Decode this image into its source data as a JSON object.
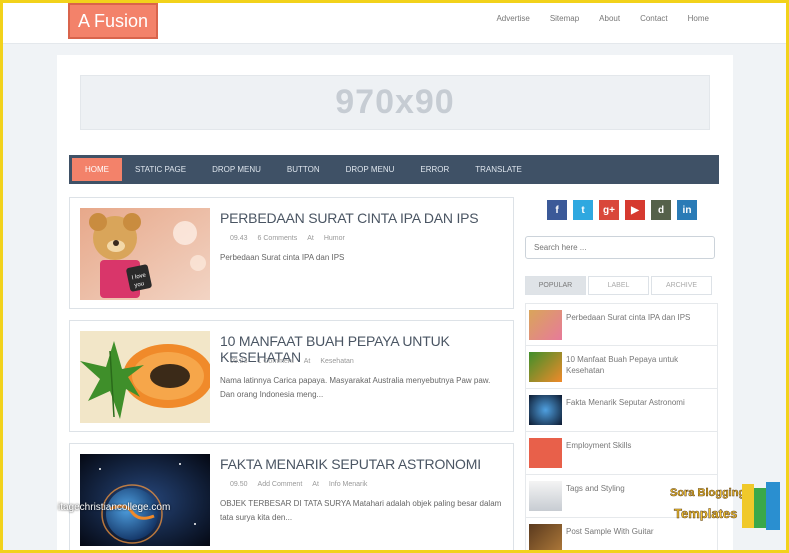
{
  "site": {
    "logo": "A Fusion"
  },
  "topnav": [
    "Advertise",
    "Sitemap",
    "About",
    "Contact",
    "Home"
  ],
  "ad_banner": "970x90",
  "mainnav": [
    "HOME",
    "STATIC PAGE",
    "DROP MENU",
    "BUTTON",
    "DROP MENU",
    "ERROR",
    "TRANSLATE"
  ],
  "posts": [
    {
      "title": "Perbedaan Surat Cinta IPA dan IPS",
      "time": "09.43",
      "comments": "6 Comments",
      "at": "At",
      "label": "Humor",
      "excerpt": "Perbedaan Surat cinta IPA dan IPS"
    },
    {
      "title": "10 Manfaat Buah Pepaya untuk Kesehatan",
      "time": "09.23",
      "comments": "1 Comment",
      "at": "At",
      "label": "Kesehatan",
      "excerpt": "Nama latinnya Carica papaya. Masyarakat Australia menyebutnya Paw paw. Dan orang Indonesia meng..."
    },
    {
      "title": "Fakta Menarik Seputar Astronomi",
      "time": "09.50",
      "comments": "Add Comment",
      "at": "At",
      "label": "Info Menarik",
      "excerpt": "OBJEK TERBESAR DI TATA SURYA Matahari adalah objek paling besar dalam tata surya kita den..."
    }
  ],
  "social": [
    {
      "icon": "facebook-icon",
      "glyph": "f",
      "color": "#3b5998"
    },
    {
      "icon": "twitter-icon",
      "glyph": "t",
      "color": "#2fa8e0"
    },
    {
      "icon": "google-plus-icon",
      "glyph": "g+",
      "color": "#d9473a"
    },
    {
      "icon": "youtube-icon",
      "glyph": "▶",
      "color": "#d63a2f"
    },
    {
      "icon": "digg-icon",
      "glyph": "d",
      "color": "#55614a"
    },
    {
      "icon": "linkedin-icon",
      "glyph": "in",
      "color": "#2a7bb6"
    }
  ],
  "search": {
    "placeholder": "Search here ..."
  },
  "tabs": [
    "POPULAR",
    "LABEL",
    "ARCHIVE"
  ],
  "popular": [
    "Perbedaan Surat cinta IPA dan IPS",
    "10 Manfaat Buah Pepaya untuk Kesehatan",
    "Fakta Menarik Seputar Astronomi",
    "Employment Skills",
    "Tags and Styling",
    "Post Sample With Guitar"
  ],
  "watermark": "itagechristiancollege.com",
  "badge": {
    "line1": "Sora Blogging",
    "line2": "Templates"
  }
}
